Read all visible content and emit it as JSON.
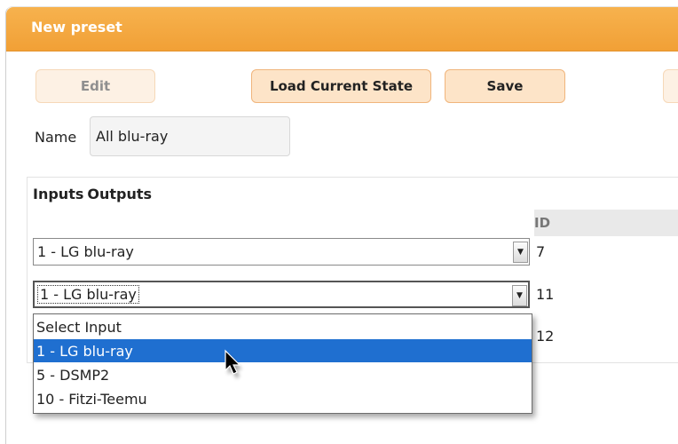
{
  "dialog": {
    "title": "New preset"
  },
  "toolbar": {
    "edit_label": "Edit",
    "load_label": "Load Current State",
    "save_label": "Save"
  },
  "name_field": {
    "label": "Name",
    "value": "All blu-ray"
  },
  "tabs": {
    "inputs": "Inputs",
    "outputs": "Outputs"
  },
  "table": {
    "id_header": "ID",
    "rows": [
      {
        "input": "1 - LG blu-ray",
        "id": "7"
      },
      {
        "input": "1 - LG blu-ray",
        "id": "11"
      },
      {
        "id": "12"
      }
    ]
  },
  "dropdown": {
    "options": [
      "Select Input",
      "1 - LG blu-ray",
      "5 - DSMP2",
      "10 - Fitzi-Teemu"
    ],
    "highlighted": "1 - LG blu-ray"
  },
  "colors": {
    "accent": "#f2a43a",
    "button_bg": "#fde4c8",
    "highlight": "#1f6fd0"
  }
}
